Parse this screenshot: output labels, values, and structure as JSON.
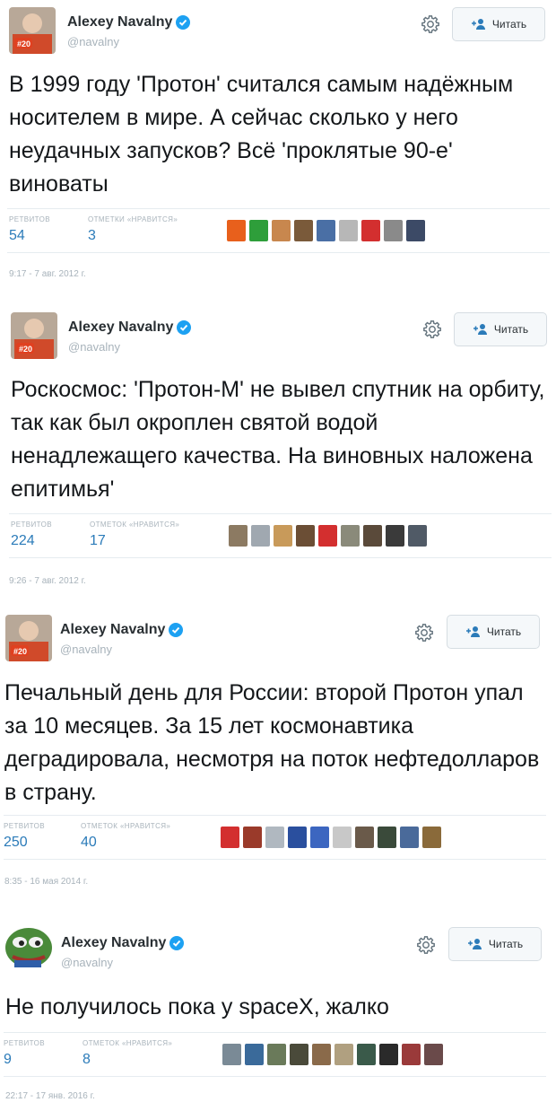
{
  "tweets": [
    {
      "author": "Alexey Navalny",
      "handle": "@navalny",
      "follow_label": "Читать",
      "text": "В 1999 году 'Протон' считался самым надёжным носителем в мире. А сейчас сколько у него неудачных запусков? Всё 'проклятые 90-е' виноваты",
      "retweets_label": "РЕТВИТОВ",
      "retweets": "54",
      "likes_label": "ОТМЕТКИ «НРАВИТСЯ»",
      "likes": "3",
      "timestamp": "9:17 - 7 авг. 2012 г."
    },
    {
      "author": "Alexey Navalny",
      "handle": "@navalny",
      "follow_label": "Читать",
      "text": "Роскосмос: 'Протон-М' не вывел спутник на орбиту, так как был окроплен святой водой ненадлежащего качества. На виновных наложена епитимья'",
      "retweets_label": "РЕТВИТОВ",
      "retweets": "224",
      "likes_label": "ОТМЕТОК «НРАВИТСЯ»",
      "likes": "17",
      "timestamp": "9:26 - 7 авг. 2012 г."
    },
    {
      "author": "Alexey Navalny",
      "handle": "@navalny",
      "follow_label": "Читать",
      "text": "Печальный день для России: второй Протон упал за 10 месяцев. За 15 лет космонавтика деградировала, несмотря на поток нефтедолларов в страну.",
      "retweets_label": "РЕТВИТОВ",
      "retweets": "250",
      "likes_label": "ОТМЕТОК «НРАВИТСЯ»",
      "likes": "40",
      "timestamp": "8:35 - 16 мая 2014 г."
    },
    {
      "author": "Alexey Navalny",
      "handle": "@navalny",
      "follow_label": "Читать",
      "text": "Не получилось пока у spaceX, жалко",
      "retweets_label": "РЕТВИТОВ",
      "retweets": "9",
      "likes_label": "ОТМЕТОК «НРАВИТСЯ»",
      "likes": "8",
      "timestamp": "22:17 - 17 янв. 2016 г."
    }
  ],
  "avatar_badge": "#20",
  "colors": {
    "link_blue": "#2b7bb9",
    "verified_blue": "#1da1f2",
    "muted": "#a8b3bb"
  },
  "face_colors": [
    [
      "#e8601c",
      "#2e9e3a",
      "#c8874e",
      "#7a5a3a",
      "#4a6fa5",
      "#b7b7b7",
      "#d32f2f",
      "#8a8a8a",
      "#3c4a66"
    ],
    [
      "#8c7a62",
      "#a0a8b0",
      "#c89a5a",
      "#6b4e35",
      "#d32f2f",
      "#8a8a7a",
      "#5a4a3a",
      "#3a3a3a",
      "#505a66"
    ],
    [
      "#d32f2f",
      "#9a3a2a",
      "#b0b8c0",
      "#2a4f9e",
      "#3c66c0",
      "#c8c8c8",
      "#6a5a4a",
      "#3a4a3a",
      "#4a6a9a",
      "#8a6a3a"
    ],
    [
      "#7a8a96",
      "#3a6a9a",
      "#6a7a5a",
      "#4a4a3a",
      "#8a6a4a",
      "#b0a080",
      "#3a5a4a",
      "#2a2a2a",
      "#9a3a3a",
      "#6a4a4a"
    ]
  ],
  "icons": {
    "gear": "gear-icon",
    "verified": "verified-badge-icon",
    "follow": "follow-plus-icon"
  }
}
